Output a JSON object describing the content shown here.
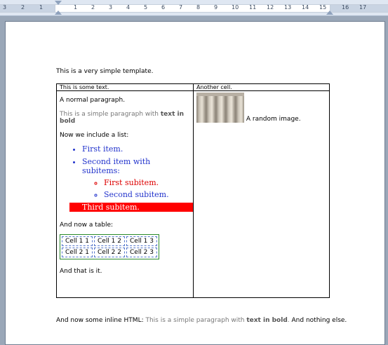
{
  "ruler": {
    "ticks": [
      "3",
      "2",
      "1",
      "1",
      "2",
      "3",
      "4",
      "5",
      "6",
      "7",
      "8",
      "9",
      "10",
      "11",
      "12",
      "13",
      "14",
      "15",
      "16",
      "17"
    ]
  },
  "document": {
    "intro": "This is a very simple template.",
    "table": {
      "header_left": "This is some text.",
      "header_right": "Another cell.",
      "normal_paragraph": "A normal paragraph.",
      "simple_paragraph_prefix": "This is a simple paragraph with ",
      "simple_paragraph_bold": "text in bold",
      "list_intro": "Now we include a list:",
      "list": {
        "item1": "First item.",
        "item2": "Second item with subitems:",
        "sub1": "First subitem.",
        "sub2": "Second subitem.",
        "item3": "Third subitem."
      },
      "table_intro": "And now a table:",
      "inner_table": [
        [
          "Cell 1 1",
          "Cell 1 2",
          "Cell 1 3"
        ],
        [
          "Cell 2 1",
          "Cell 2 2",
          "Cell 2 3"
        ]
      ],
      "outro": "And that is it.",
      "image_caption": "A random image."
    },
    "footer": {
      "prefix": "And now some inline  HTML: ",
      "gray_text": "This is a simple paragraph with ",
      "gray_bold": "text in bold",
      "gray_end": ".",
      "suffix": "  And nothing else."
    }
  },
  "colors": {
    "list_blue": "#2233cc",
    "list_red": "#dd0000",
    "highlight": "#ff0000",
    "inner_table_border": "#2a8a2a"
  }
}
